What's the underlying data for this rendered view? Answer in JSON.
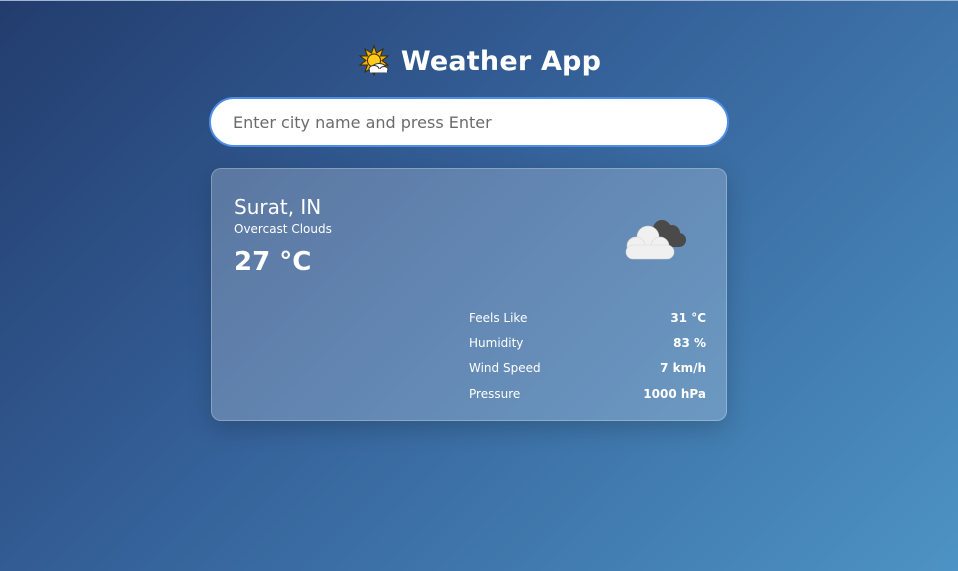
{
  "header": {
    "icon": "sun-behind-cloud-icon",
    "title": "Weather App"
  },
  "search": {
    "placeholder": "Enter city name and press Enter",
    "value": ""
  },
  "weather": {
    "city": "Surat, IN",
    "description": "Overcast Clouds",
    "temperature": "27 °C",
    "icon": "overcast-clouds-icon",
    "details": [
      {
        "label": "Feels Like",
        "value": "31 °C"
      },
      {
        "label": "Humidity",
        "value": "83 %"
      },
      {
        "label": "Wind Speed",
        "value": "7 km/h"
      },
      {
        "label": "Pressure",
        "value": "1000 hPa"
      }
    ]
  },
  "colors": {
    "background_start": "#233c6e",
    "background_end": "#4d93c4",
    "input_border": "#4f8ee6",
    "text": "#ffffff"
  }
}
